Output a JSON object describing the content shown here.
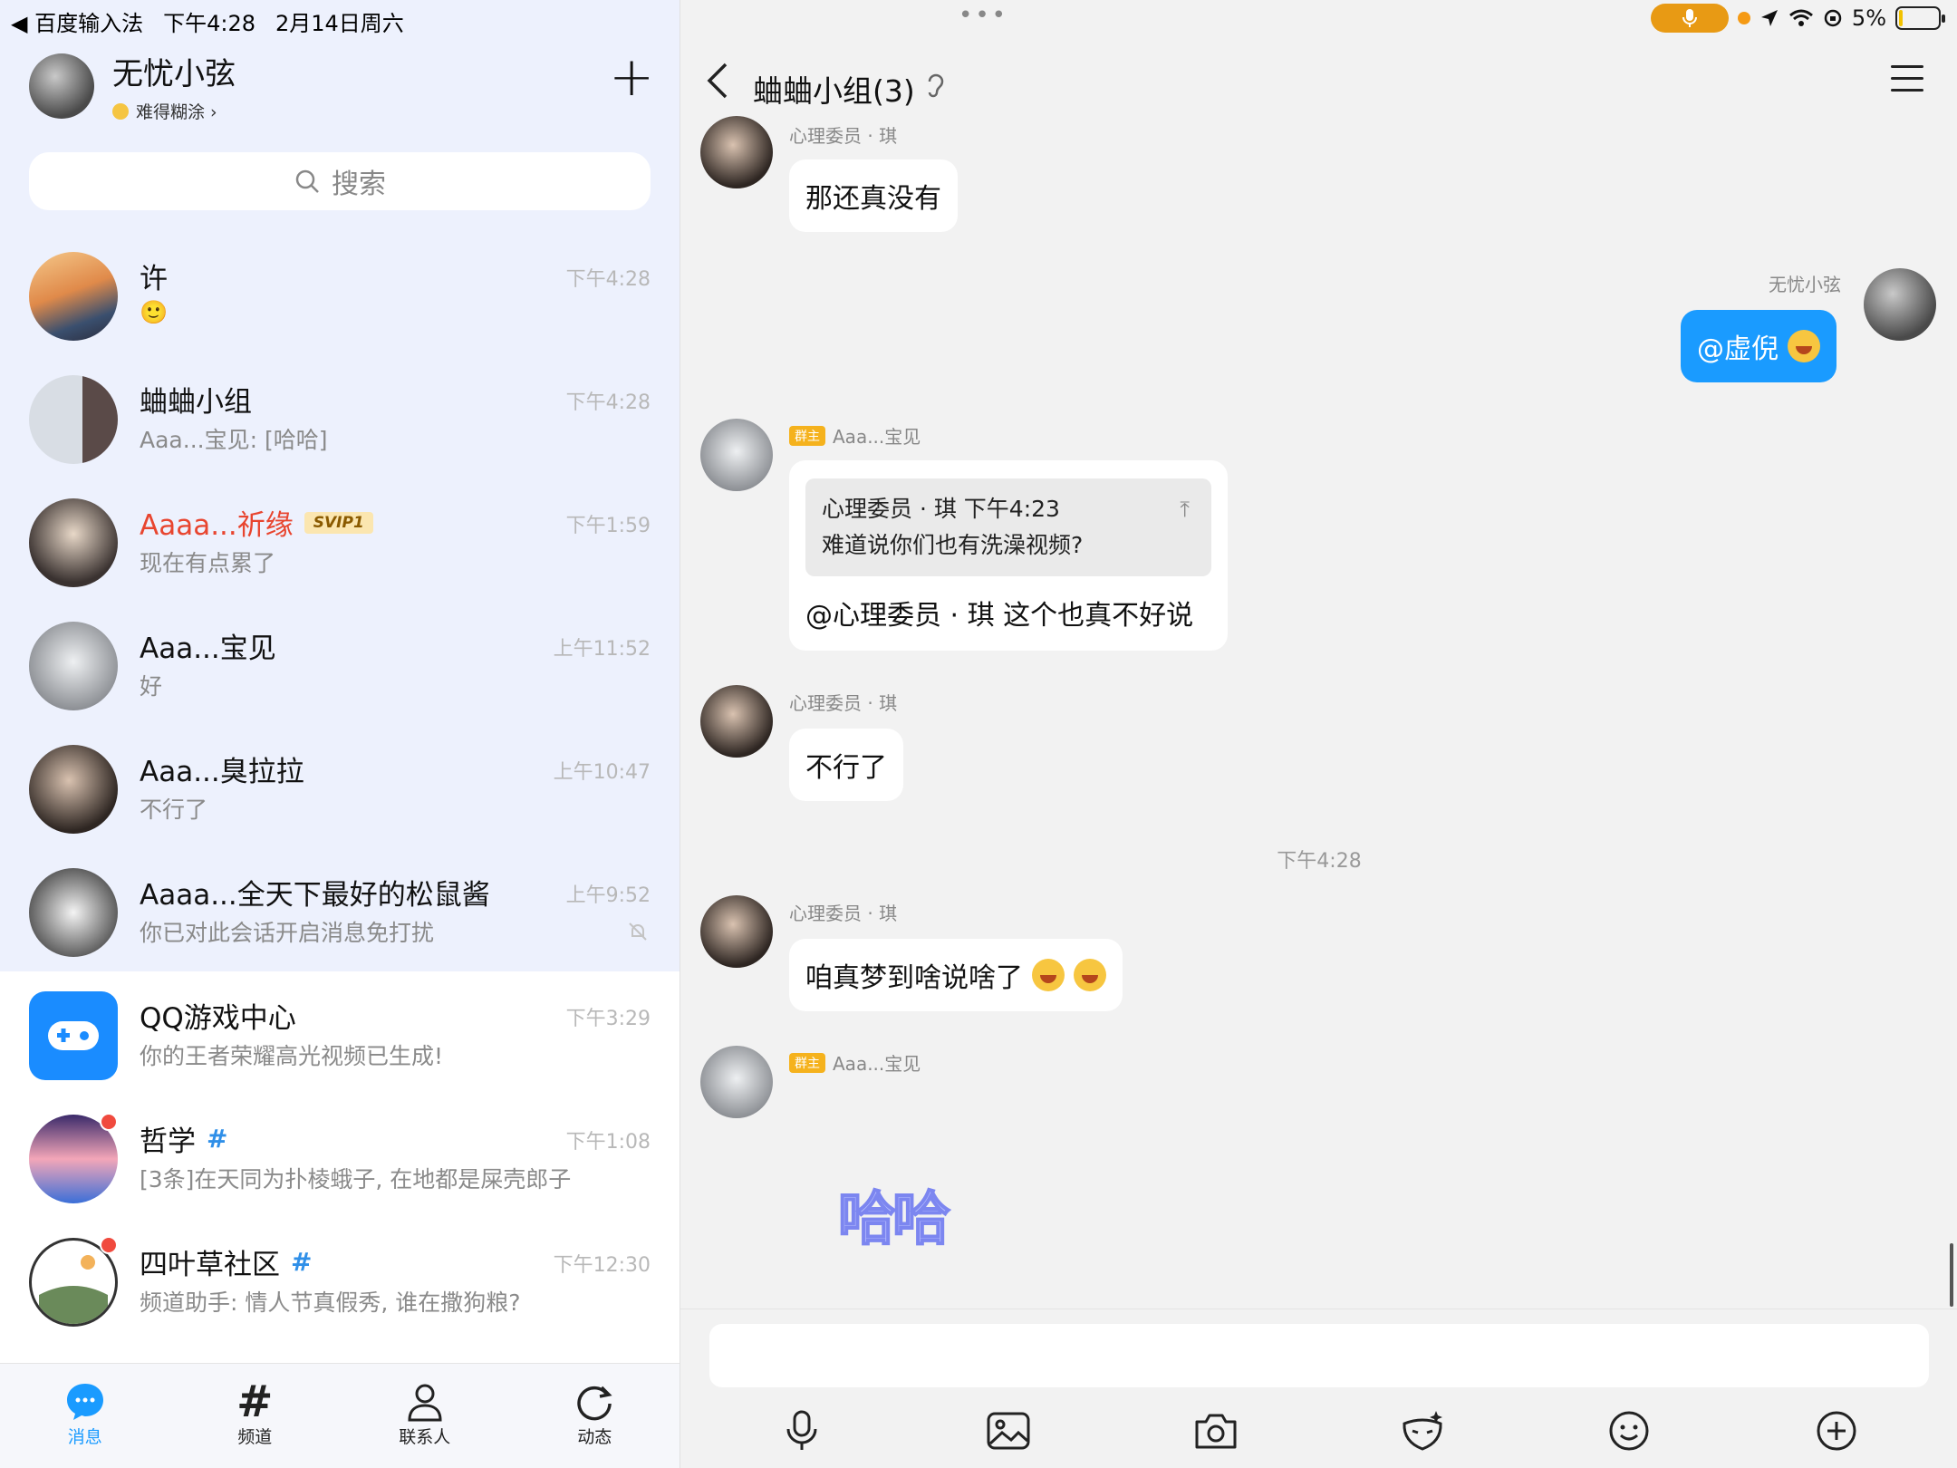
{
  "status_bar": {
    "back_app": "◀ 百度输入法",
    "time": "下午4:28",
    "date": "2月14日周六",
    "battery": "5%",
    "battery_level": 0.05
  },
  "profile": {
    "name": "无忧小弦",
    "status": "难得糊涂 ›"
  },
  "search": {
    "placeholder": "搜索"
  },
  "conversations": [
    {
      "name": "许",
      "preview": "🙂",
      "time": "下午4:28"
    },
    {
      "name": "蛐蛐小组",
      "preview": "Aaa...宝见: [哈哈]",
      "time": "下午4:28"
    },
    {
      "name": "Aaaa...祈缘",
      "badge": "SVIP1",
      "preview": "现在有点累了",
      "time": "下午1:59"
    },
    {
      "name": "Aaa...宝见",
      "preview": "好",
      "time": "上午11:52"
    },
    {
      "name": "Aaa...臭拉拉",
      "preview": "不行了",
      "time": "上午10:47"
    },
    {
      "name": "Aaaa...全天下最好的松鼠酱",
      "preview": "你已对此会话开启消息免打扰",
      "time": "上午9:52"
    },
    {
      "name": "QQ游戏中心",
      "preview": "你的王者荣耀高光视频已生成!",
      "time": "下午3:29"
    },
    {
      "name": "哲学",
      "preview": "[3条]在天同为扑棱蛾子, 在地都是屎壳郎子",
      "time": "下午1:08"
    },
    {
      "name": "四叶草社区",
      "preview": "频道助手: 情人节真假秀, 谁在撒狗粮?",
      "time": "下午12:30"
    }
  ],
  "tabs": [
    {
      "label": "消息"
    },
    {
      "label": "频道"
    },
    {
      "label": "联系人"
    },
    {
      "label": "动态"
    }
  ],
  "chat": {
    "title": "蛐蛐小组(3)",
    "messages": {
      "m1_sender": "心理委员 · 琪",
      "m1_text": "那还真没有",
      "m2_sender": "无忧小弦",
      "m2_text": "@虚倪",
      "m3_badge": "群主",
      "m3_sender": "Aaa...宝见",
      "m3_quote_head": "心理委员 · 琪  下午4:23",
      "m3_quote_body": "难道说你们也有洗澡视频?",
      "m3_text": "@心理委员 · 琪 这个也真不好说",
      "m4_sender": "心理委员 · 琪",
      "m4_text": "不行了",
      "divider": "下午4:28",
      "m5_sender": "心理委员 · 琪",
      "m5_text": "咱真梦到啥说啥了",
      "m6_badge": "群主",
      "m6_sender": "Aaa...宝见",
      "m6_sticker": "哈哈"
    }
  }
}
